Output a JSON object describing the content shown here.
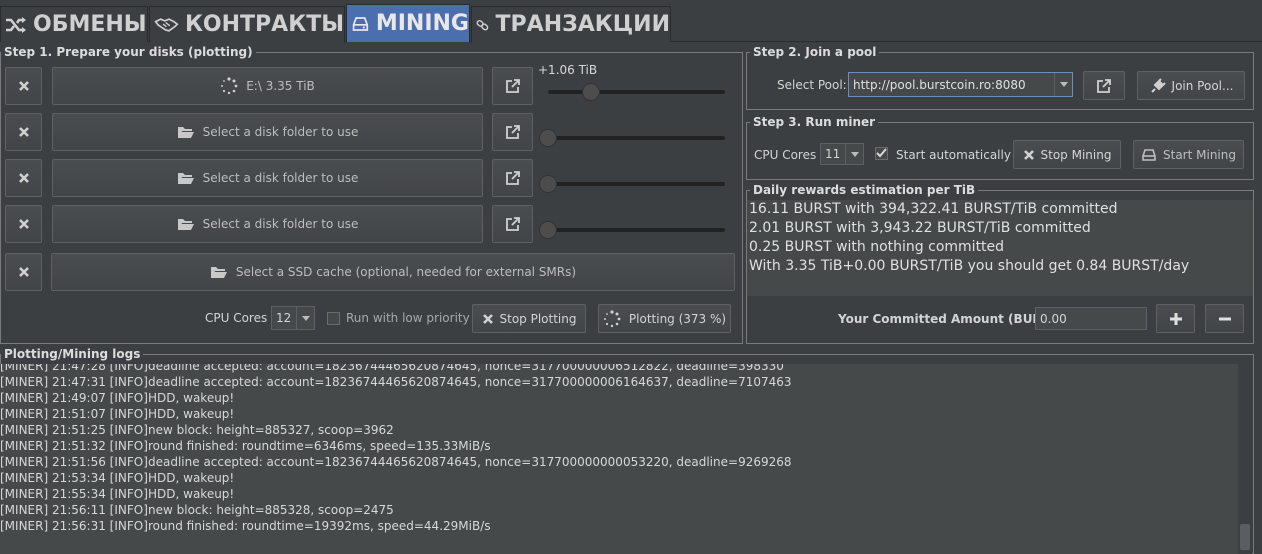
{
  "tabs": [
    {
      "label": "ОБМЕНЫ",
      "icon": "shuffle-icon"
    },
    {
      "label": "КОНТРАКТЫ",
      "icon": "handshake-icon"
    },
    {
      "label": "MINING",
      "icon": "drive-icon",
      "active": true
    },
    {
      "label": "ТРАНЗАКЦИИ",
      "icon": "link-icon"
    }
  ],
  "step1": {
    "title": "Step 1. Prepare your disks (plotting)",
    "disks": [
      {
        "label": "E:\\ 3.35 TiB",
        "icon": "spinner-icon",
        "slider_label": "+1.06 TiB",
        "slider_level": 0.27
      },
      {
        "label": "Select a disk folder to use",
        "icon": "folder-open-icon",
        "slider_level": 0
      },
      {
        "label": "Select a disk folder to use",
        "icon": "folder-open-icon",
        "slider_level": 0
      },
      {
        "label": "Select a disk folder to use",
        "icon": "folder-open-icon",
        "slider_level": 0
      }
    ],
    "ssd_label": "Select a SSD cache (optional, needed for external SMRs)",
    "cpu_cores_label": "CPU Cores",
    "cpu_cores_value": "12",
    "low_priority_label": "Run with low priority",
    "stop_plotting_label": "Stop Plotting",
    "plotting_status_label": "Plotting (373 %)"
  },
  "step2": {
    "title": "Step 2. Join a pool",
    "select_pool_label": "Select Pool:",
    "pool_value": "http://pool.burstcoin.ro:8080",
    "join_pool_label": "Join Pool..."
  },
  "step3": {
    "title": "Step 3. Run miner",
    "cpu_cores_label": "CPU Cores",
    "cpu_cores_value": "11",
    "start_auto_label": "Start automatically",
    "stop_mining_label": "Stop Mining",
    "start_mining_label": "Start Mining"
  },
  "rewards": {
    "title": "Daily rewards estimation per TiB",
    "lines": [
      "16.11 BURST with 394,322.41 BURST/TiB committed",
      "2.01 BURST with 3,943.22 BURST/TiB committed",
      "0.25 BURST with nothing committed",
      "",
      "With 3.35 TiB+0.00 BURST/TiB you should get 0.84 BURST/day"
    ],
    "committed_label": "Your Committed Amount (BURST):",
    "committed_value": "0.00"
  },
  "logs": {
    "title": "Plotting/Mining logs",
    "entries": [
      {
        "time": "[MINER] 21:47:28 [INFO]",
        "msg": "deadline accepted: account=18236744465620874645, nonce=317700000006512822, deadline=398330"
      },
      {
        "time": "[MINER] 21:47:31 [INFO]",
        "msg": "deadline accepted: account=18236744465620874645, nonce=317700000006164637, deadline=7107463"
      },
      {
        "time": "[MINER] 21:49:07 [INFO]",
        "msg": "HDD, wakeup!"
      },
      {
        "time": "[MINER] 21:51:07 [INFO]",
        "msg": "HDD, wakeup!"
      },
      {
        "time": "[MINER] 21:51:25 [INFO]",
        "msg": "new block: height=885327, scoop=3962"
      },
      {
        "time": "[MINER] 21:51:32 [INFO]",
        "msg": "round finished: roundtime=6346ms, speed=135.33MiB/s"
      },
      {
        "time": "[MINER] 21:51:56 [INFO]",
        "msg": "deadline accepted: account=18236744465620874645, nonce=317700000000053220, deadline=9269268"
      },
      {
        "time": "[MINER] 21:53:34 [INFO]",
        "msg": "HDD, wakeup!"
      },
      {
        "time": "[MINER] 21:55:34 [INFO]",
        "msg": "HDD, wakeup!"
      },
      {
        "time": "[MINER] 21:56:11 [INFO]",
        "msg": "new block: height=885328, scoop=2475"
      },
      {
        "time": "[MINER] 21:56:31 [INFO]",
        "msg": "round finished: roundtime=19392ms, speed=44.29MiB/s"
      }
    ]
  },
  "colors": {
    "accent": "#4b6eaf",
    "background": "#3c3f41"
  }
}
